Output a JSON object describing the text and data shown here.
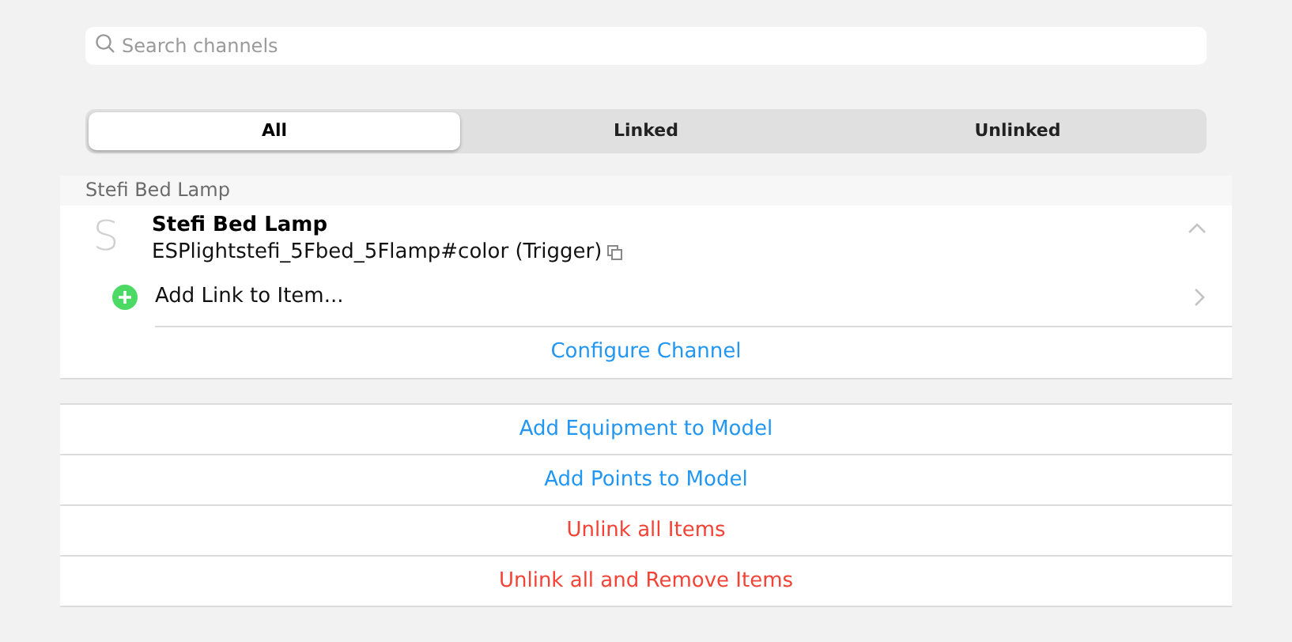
{
  "search": {
    "placeholder": "Search channels"
  },
  "tabs": [
    {
      "label": "All",
      "selected": true
    },
    {
      "label": "Linked",
      "selected": false
    },
    {
      "label": "Unlinked",
      "selected": false
    }
  ],
  "group": {
    "title": "Stefi Bed Lamp",
    "channel": {
      "avatar": "S",
      "title": "Stefi Bed Lamp",
      "uid": "ESPlightstefi_5Fbed_5Flamp#color (Trigger)",
      "expanded": true,
      "add_link": "Add Link to Item...",
      "configure": "Configure Channel"
    }
  },
  "actions": [
    {
      "label": "Add Equipment to Model",
      "kind": "normal"
    },
    {
      "label": "Add Points to Model",
      "kind": "normal"
    },
    {
      "label": "Unlink all Items",
      "kind": "danger"
    },
    {
      "label": "Unlink all and Remove Items",
      "kind": "danger"
    }
  ]
}
